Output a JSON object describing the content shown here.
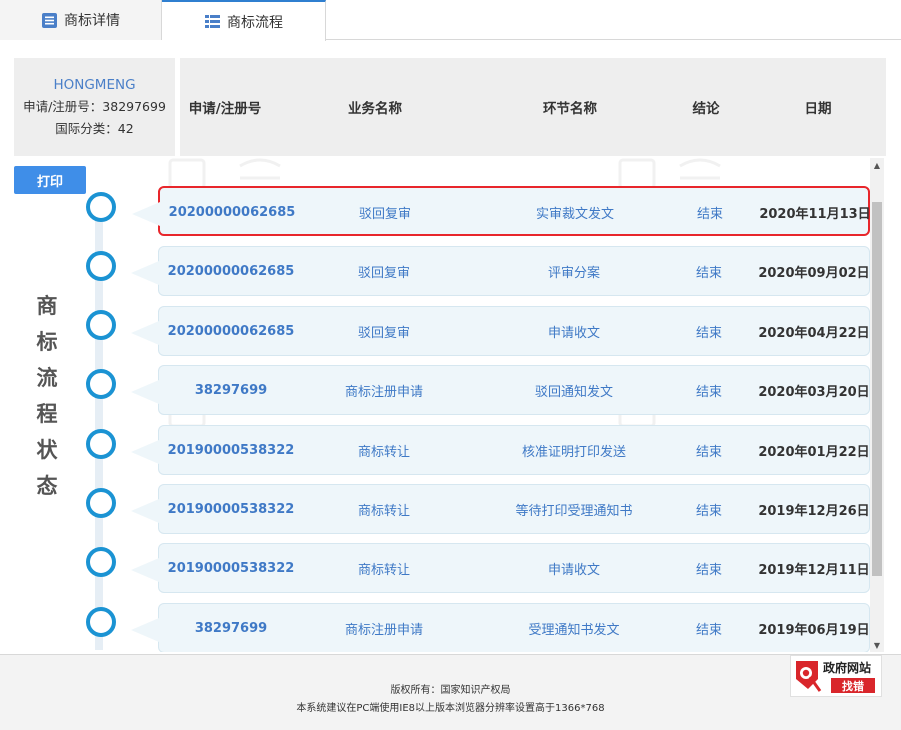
{
  "tabs": [
    {
      "label": "商标详情",
      "active": false,
      "icon": "document-list-icon"
    },
    {
      "label": "商标流程",
      "active": true,
      "icon": "flow-list-icon"
    }
  ],
  "mark": {
    "name": "HONGMENG",
    "reg_line": "申请/注册号：38297699",
    "class_line": "国际分类：42"
  },
  "columns": {
    "reg_no": "申请/注册号",
    "business": "业务名称",
    "step": "环节名称",
    "result": "结论",
    "date": "日期"
  },
  "print_label": "打印",
  "status_title": [
    "商",
    "标",
    "流",
    "程",
    "状",
    "态"
  ],
  "rows": [
    {
      "reg_no": "20200000062685",
      "business": "驳回复审",
      "step": "实审裁文发文",
      "result": "结束",
      "date": "2020年11月13日",
      "selected": true
    },
    {
      "reg_no": "20200000062685",
      "business": "驳回复审",
      "step": "评审分案",
      "result": "结束",
      "date": "2020年09月02日"
    },
    {
      "reg_no": "20200000062685",
      "business": "驳回复审",
      "step": "申请收文",
      "result": "结束",
      "date": "2020年04月22日"
    },
    {
      "reg_no": "38297699",
      "business": "商标注册申请",
      "step": "驳回通知发文",
      "result": "结束",
      "date": "2020年03月20日"
    },
    {
      "reg_no": "20190000538322",
      "business": "商标转让",
      "step": "核准证明打印发送",
      "result": "结束",
      "date": "2020年01月22日"
    },
    {
      "reg_no": "20190000538322",
      "business": "商标转让",
      "step": "等待打印受理通知书",
      "result": "结束",
      "date": "2019年12月26日"
    },
    {
      "reg_no": "20190000538322",
      "business": "商标转让",
      "step": "申请收文",
      "result": "结束",
      "date": "2019年12月11日"
    },
    {
      "reg_no": "38297699",
      "business": "商标注册申请",
      "step": "受理通知书发文",
      "result": "结束",
      "date": "2019年06月19日"
    }
  ],
  "footer": {
    "copyright": "版权所有：国家知识产权局",
    "notice": "本系统建议在PC端使用IE8以上版本浏览器分辨率设置高于1366*768"
  },
  "gov_badge": {
    "line1": "政府网站",
    "line2": "找错"
  },
  "colors": {
    "accent": "#3f8ee8",
    "link": "#3f79c6",
    "node": "#1b93d3",
    "selected_border": "#e8262b",
    "row_bg": "#eef6fa"
  }
}
